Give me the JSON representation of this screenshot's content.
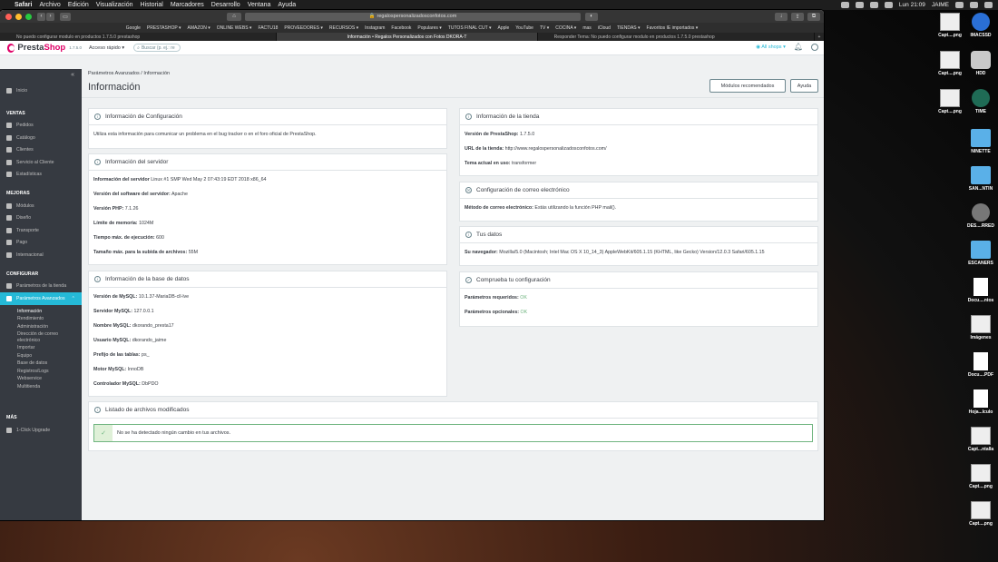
{
  "menubar": {
    "app": "Safari",
    "items": [
      "Archivo",
      "Edición",
      "Visualización",
      "Historial",
      "Marcadores",
      "Desarrollo",
      "Ventana",
      "Ayuda"
    ],
    "clock": "Lun 21:09",
    "user": "JAIME"
  },
  "browser": {
    "url": "regalospersonalizadosconfotos.com",
    "favorites": [
      "Google",
      "PRESTASHOP ▾",
      "AMAZON ▾",
      "ONLINE WEBS ▾",
      "FACTU18",
      "PROVEEDORES ▾",
      "RECURSOS ▾",
      "Instagram",
      "Facebook",
      "Populares ▾",
      "TUTOS FINAL CUT ▾",
      "Apple",
      "YouTube",
      "TV ▾",
      "COCINA ▾",
      "mas",
      "iCloud",
      "TIENDAS ▾",
      "Favoritos IE importados ▾"
    ],
    "tabs": [
      {
        "label": "No puedo configurar modulo en productos 1.7.5.0 prestashop",
        "active": false
      },
      {
        "label": "Información • Regalos Personalizados con Fotos DKORA-T",
        "active": true
      },
      {
        "label": "Responder Tema: No puedo configurar modulo en productos 1.7.5.0 prestashop",
        "active": false
      }
    ]
  },
  "header": {
    "logo_presta": "Presta",
    "logo_shop": "Shop",
    "version": "1.7.5.0",
    "quick_access": "Acceso rápido ▾",
    "search_placeholder": "Buscar (p. ej.: re",
    "all_shops": "All shops ▾"
  },
  "sidebar": {
    "collapse": "«",
    "home": "Inicio",
    "sections": [
      {
        "title": "VENTAS",
        "items": [
          "Pedidos",
          "Catálogo",
          "Clientes",
          "Servicio al Cliente",
          "Estadísticas"
        ]
      },
      {
        "title": "MEJORAS",
        "items": [
          "Módulos",
          "Diseño",
          "Transporte",
          "Pago",
          "Internacional"
        ]
      },
      {
        "title": "CONFIGURAR",
        "items": [
          "Parámetros de la tienda",
          "Parámetros Avanzados"
        ]
      },
      {
        "title": "MÁS",
        "items": [
          "1-Click Upgrade"
        ]
      }
    ],
    "submenu": [
      "Información",
      "Rendimiento",
      "Administración",
      "Dirección de correo electrónico",
      "Importar",
      "Equipo",
      "Base de datos",
      "Registros/Logs",
      "Webservice",
      "Multitienda"
    ]
  },
  "page": {
    "breadcrumb": "Parámetros Avanzados  /  Información",
    "title": "Información",
    "btn_modules": "Módulos recomendados",
    "btn_help": "Ayuda"
  },
  "config_panel": {
    "title": "Información de Configuración",
    "text": "Utiliza esta información para comunicar un problema en el bug tracker o en el foro oficial de PrestaShop."
  },
  "server_panel": {
    "title": "Información del servidor",
    "rows": [
      {
        "label": "Información del servidor",
        "value": "Linux #1 SMP Wed May 2 07:43:19 EDT 2018 x86_64"
      },
      {
        "label": "Versión del software del servidor:",
        "value": "Apache"
      },
      {
        "label": "Versión PHP:",
        "value": "7.1.26"
      },
      {
        "label": "Límite de memoria:",
        "value": "1024M"
      },
      {
        "label": "Tiempo máx. de ejecución:",
        "value": "600"
      },
      {
        "label": "Tamaño máx. para la subida de archivos:",
        "value": "55M"
      }
    ]
  },
  "db_panel": {
    "title": "Información de la base de datos",
    "rows": [
      {
        "label": "Versión de MySQL:",
        "value": "10.1.37-MariaDB-cll-lve"
      },
      {
        "label": "Servidor MySQL:",
        "value": "127.0.0.1"
      },
      {
        "label": "Nombre MySQL:",
        "value": "dkorando_presta17"
      },
      {
        "label": "Usuario MySQL:",
        "value": "dkorando_jaime"
      },
      {
        "label": "Prefijo de las tablas:",
        "value": "ps_"
      },
      {
        "label": "Motor MySQL:",
        "value": "InnoDB"
      },
      {
        "label": "Controlador MySQL:",
        "value": "DbPDO"
      }
    ]
  },
  "shop_panel": {
    "title": "Información de la tienda",
    "rows": [
      {
        "label": "Versión de PrestaShop:",
        "value": "1.7.5.0"
      },
      {
        "label": "URL de la tienda:",
        "value": "http://www.regalospersonalizadosconfotos.com/"
      },
      {
        "label": "Tema actual en uso:",
        "value": "transformer"
      }
    ]
  },
  "mail_panel": {
    "title": "Configuración de correo electrónico",
    "label": "Método de correo electrónico:",
    "value": "Estás utilizando la función PHP mail()."
  },
  "data_panel": {
    "title": "Tus datos",
    "label": "Su navegador:",
    "value": "Mozilla/5.0 (Macintosh; Intel Mac OS X 10_14_3) AppleWebKit/605.1.15 (KHTML, like Gecko) Version/12.0.3 Safari/605.1.15"
  },
  "check_panel": {
    "title": "Comprueba tu configuración",
    "required_label": "Parámetros requeridos:",
    "required_value": "OK",
    "optional_label": "Parámetros opcionales:",
    "optional_value": "OK"
  },
  "files_panel": {
    "title": "Listado de archivos modificados",
    "message": "No se ha detectado ningún cambio en tus archivos."
  },
  "desktop": [
    {
      "label": "Capt....png",
      "kind": "shot"
    },
    {
      "label": "IMACSSD",
      "kind": "round"
    },
    {
      "label": "Capt....png",
      "kind": "shot"
    },
    {
      "label": "HDD",
      "kind": "disk"
    },
    {
      "label": "Capt....png",
      "kind": "shot"
    },
    {
      "label": "TIME",
      "kind": "tm"
    },
    {
      "label": "NINETTE",
      "kind": "folder"
    },
    {
      "label": "SAN...NTIN",
      "kind": "folder"
    },
    {
      "label": "DES....RRED",
      "kind": "cam"
    },
    {
      "label": "ESCANERS",
      "kind": "folder"
    },
    {
      "label": "Docu....ntos",
      "kind": "doc"
    },
    {
      "label": "Imágenes",
      "kind": "shot"
    },
    {
      "label": "Docu....PDF",
      "kind": "doc"
    },
    {
      "label": "Hoja...lculo",
      "kind": "doc"
    },
    {
      "label": "Capt...ntalla",
      "kind": "shot"
    },
    {
      "label": "Capt....png",
      "kind": "shot"
    },
    {
      "label": "Capt....png",
      "kind": "shot"
    }
  ],
  "colors": {
    "brand_pink": "#df0067",
    "accent_blue": "#25b9d7",
    "sidebar_bg": "#363a41",
    "success_green": "#70b580"
  }
}
